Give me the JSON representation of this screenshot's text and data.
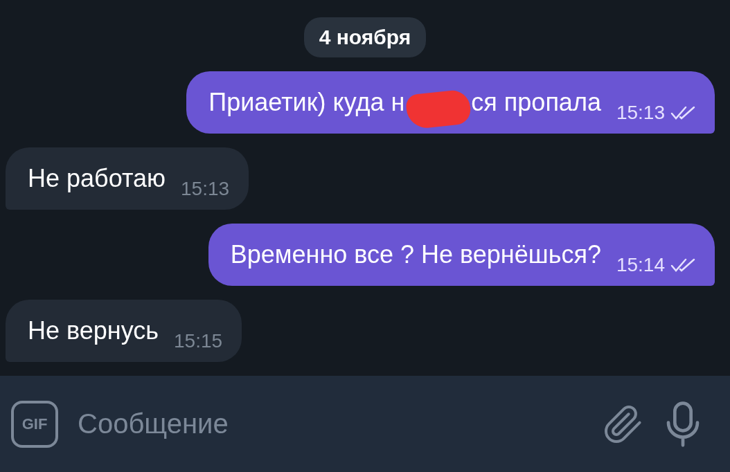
{
  "date_pill": "4 ноября",
  "messages": [
    {
      "kind": "outgoing",
      "segments": [
        {
          "kind": "text",
          "text": "Приаетик) куда н"
        },
        {
          "kind": "redaction"
        },
        {
          "kind": "text",
          "text": "ся пропала"
        }
      ],
      "time": "15:13",
      "read": true
    },
    {
      "kind": "incoming",
      "segments": [
        {
          "kind": "text",
          "text": "Не работаю"
        }
      ],
      "time": "15:13"
    },
    {
      "kind": "outgoing",
      "segments": [
        {
          "kind": "text",
          "text": "Временно все ? Не вернёшься?"
        }
      ],
      "time": "15:14",
      "read": true
    },
    {
      "kind": "incoming",
      "segments": [
        {
          "kind": "text",
          "text": "Не вернусь"
        }
      ],
      "time": "15:15"
    }
  ],
  "composer": {
    "gif_label": "GIF",
    "placeholder": "Сообщение"
  }
}
